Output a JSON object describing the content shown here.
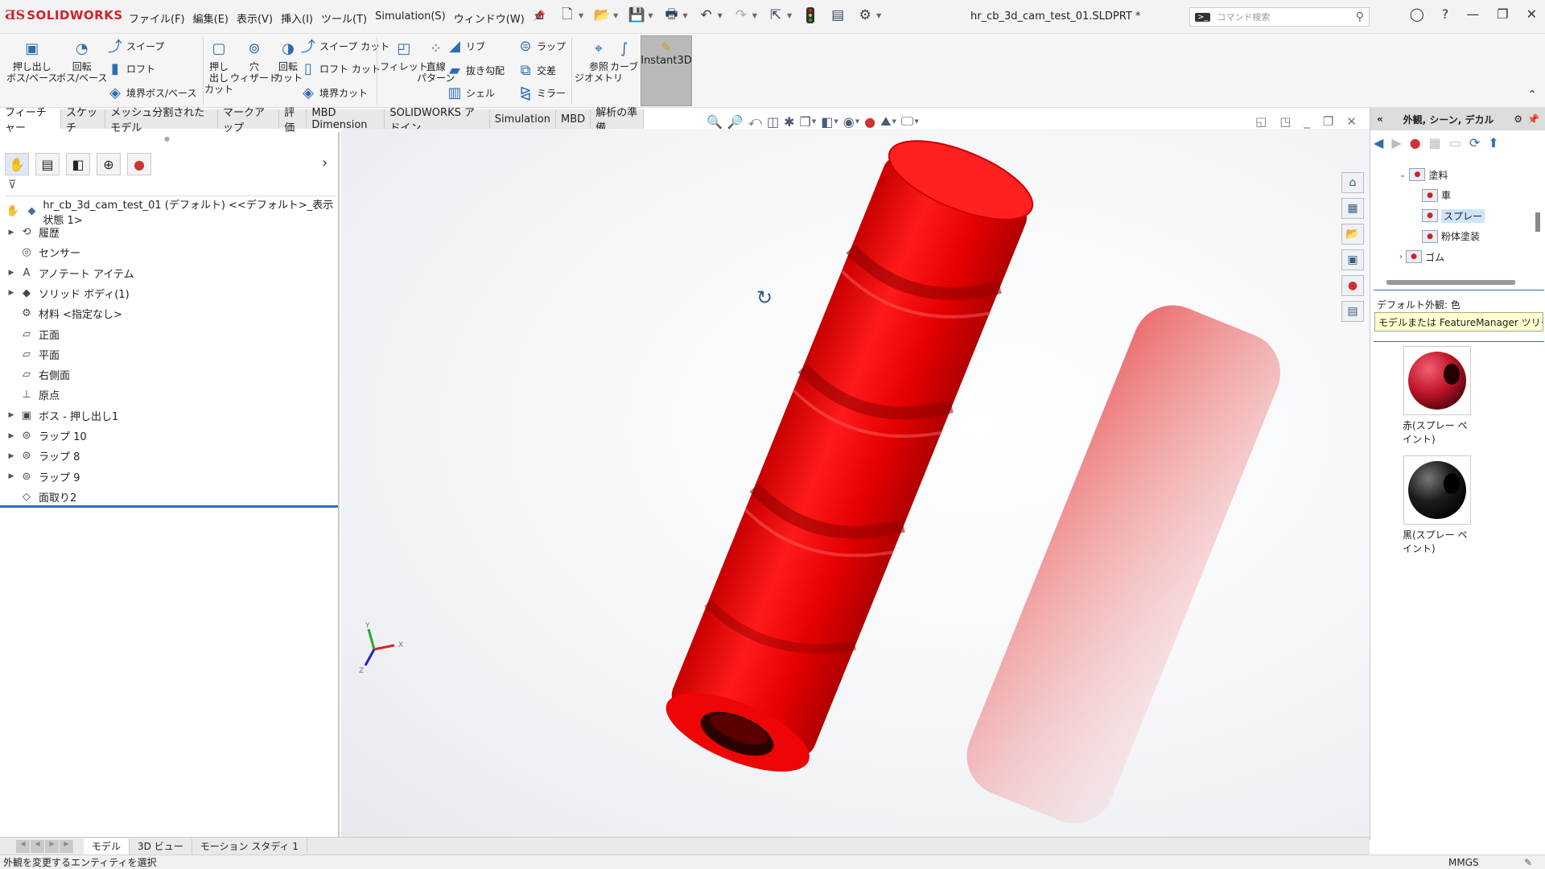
{
  "app": {
    "brand": "SOLIDWORKS",
    "doc_title": "hr_cb_3d_cam_test_01.SLDPRT *"
  },
  "menu": [
    "ファイル(F)",
    "編集(E)",
    "表示(V)",
    "挿入(I)",
    "ツール(T)",
    "Simulation(S)",
    "ウィンドウ(W)"
  ],
  "search": {
    "placeholder": "コマンド検索"
  },
  "ribbon": {
    "extrude_boss": [
      "押し出し",
      "ボス/ベース"
    ],
    "revolve_boss": [
      "回転",
      "ボス/ベース"
    ],
    "sweep": "スイープ",
    "loft": "ロフト",
    "boundary_boss": "境界ボス/ベース",
    "extrude_cut": [
      "押し",
      "出し",
      "カット"
    ],
    "hole_wizard": [
      "穴",
      "ウィザード"
    ],
    "revolve_cut": [
      "回転",
      "カット"
    ],
    "sweep_cut": "スイープ カット",
    "loft_cut": "ロフト カット",
    "boundary_cut": "境界カット",
    "fillet": "フィレット",
    "linear_pattern": [
      "直線",
      "パターン"
    ],
    "rib": "リブ",
    "draft": "抜き勾配",
    "shell": "シェル",
    "wrap": "ラップ",
    "intersect": "交差",
    "mirror": "ミラー",
    "ref_geometry": [
      "参照",
      "ジオメトリ"
    ],
    "curves": "カーブ",
    "instant3d": "Instant3D"
  },
  "tabs": [
    "フィーチャー",
    "スケッチ",
    "メッシュ分割されたモデル",
    "マークアップ",
    "評価",
    "MBD Dimension",
    "SOLIDWORKS アドイン",
    "Simulation",
    "MBD",
    "解析の準備"
  ],
  "tree": {
    "root": "hr_cb_3d_cam_test_01 (デフォルト) <<デフォルト>_表示状態 1>",
    "items": [
      {
        "label": "履歴",
        "icon": "history-icon",
        "expand": true
      },
      {
        "label": "センサー",
        "icon": "sensor-icon",
        "expand": false
      },
      {
        "label": "アノテート アイテム",
        "icon": "annotation-icon",
        "expand": true
      },
      {
        "label": "ソリッド ボディ(1)",
        "icon": "solid-body-icon",
        "expand": true
      },
      {
        "label": "材料 <指定なし>",
        "icon": "material-icon",
        "expand": false
      },
      {
        "label": "正面",
        "icon": "plane-icon",
        "expand": false
      },
      {
        "label": "平面",
        "icon": "plane-icon",
        "expand": false
      },
      {
        "label": "右側面",
        "icon": "plane-icon",
        "expand": false
      },
      {
        "label": "原点",
        "icon": "origin-icon",
        "expand": false
      },
      {
        "label": "ボス - 押し出し1",
        "icon": "extrude-icon",
        "expand": true
      },
      {
        "label": "ラップ 10",
        "icon": "wrap-icon",
        "expand": true
      },
      {
        "label": "ラップ 8",
        "icon": "wrap-icon",
        "expand": true
      },
      {
        "label": "ラップ 9",
        "icon": "wrap-icon",
        "expand": true
      },
      {
        "label": "面取り2",
        "icon": "chamfer-icon",
        "expand": false
      }
    ]
  },
  "triad": {
    "x": "X",
    "y": "Y",
    "z": "Z"
  },
  "taskpane": {
    "title": "外観, シーン, デカル",
    "tree": [
      {
        "label": "塗料",
        "level": 1,
        "expanded": true
      },
      {
        "label": "車",
        "level": 2
      },
      {
        "label": "スプレー",
        "level": 2,
        "selected": true
      },
      {
        "label": "粉体塗装",
        "level": 2
      },
      {
        "label": "ゴム",
        "level": 1,
        "expanded": false
      }
    ],
    "default_appearance": "デフォルト外観: 色",
    "tooltip": "モデルまたは FeatureManager ツリーに...",
    "swatches": [
      {
        "label": "赤(スプレー ペイント)",
        "color": "#c3182c"
      },
      {
        "label": "黒(スプレー ペイント)",
        "color": "#1c1c1c"
      }
    ]
  },
  "bottom_tabs": [
    "モデル",
    "3D ビュー",
    "モーション スタディ 1"
  ],
  "status": {
    "message": "外観を変更するエンティティを選択",
    "units": "MMGS"
  },
  "colors": {
    "part": "#f20d0d",
    "accent": "#2d6fb5",
    "brand": "#d3202a"
  }
}
